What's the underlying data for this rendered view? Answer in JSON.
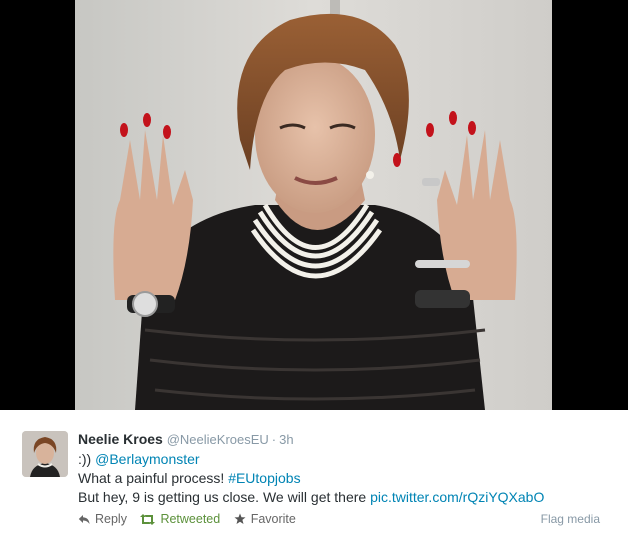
{
  "media": {
    "alt": "Photo of Neelie Kroes holding up nine fingers"
  },
  "tweet": {
    "author": {
      "fullname": "Neelie Kroes",
      "handle": "@NeelieKroesEU",
      "separator": "·",
      "time": "3h"
    },
    "lines": [
      {
        "prefix": ":)) ",
        "mention": "@Berlaymonster"
      },
      {
        "prefix": "What a painful process! ",
        "hashtag": "#EUtopjobs"
      },
      {
        "prefix": "But hey, 9 is getting us close. We will get there ",
        "link": "pic.twitter.com/rQziYQXabO"
      }
    ],
    "actions": {
      "reply": "Reply",
      "retweet": "Retweeted",
      "favorite": "Favorite",
      "flag": "Flag media"
    },
    "colors": {
      "link": "#0084b4",
      "retweeted": "#5c913b",
      "muted": "#8899a6",
      "text": "#292f33"
    }
  }
}
